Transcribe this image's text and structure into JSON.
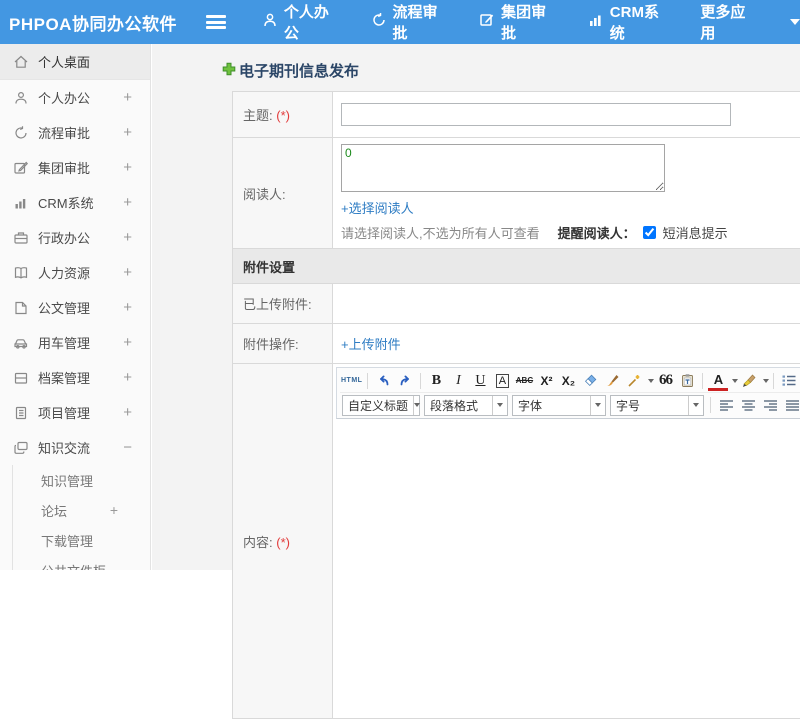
{
  "header": {
    "logo": "PHPOA协同办公软件",
    "nav": [
      {
        "label": "个人办公"
      },
      {
        "label": "流程审批"
      },
      {
        "label": "集团审批"
      },
      {
        "label": "CRM系统"
      },
      {
        "label": "更多应用"
      }
    ]
  },
  "sidebar": {
    "items": [
      {
        "label": "个人桌面",
        "toggle": ""
      },
      {
        "label": "个人办公",
        "toggle": "+"
      },
      {
        "label": "流程审批",
        "toggle": "+"
      },
      {
        "label": "集团审批",
        "toggle": "+"
      },
      {
        "label": "CRM系统",
        "toggle": "+"
      },
      {
        "label": "行政办公",
        "toggle": "+"
      },
      {
        "label": "人力资源",
        "toggle": "+"
      },
      {
        "label": "公文管理",
        "toggle": "+"
      },
      {
        "label": "用车管理",
        "toggle": "+"
      },
      {
        "label": "档案管理",
        "toggle": "+"
      },
      {
        "label": "项目管理",
        "toggle": "+"
      },
      {
        "label": "知识交流",
        "toggle": "−"
      }
    ],
    "subitems": [
      {
        "label": "知识管理",
        "toggle": ""
      },
      {
        "label": "论坛",
        "toggle": "+"
      },
      {
        "label": "下载管理",
        "toggle": ""
      },
      {
        "label": "公共文件柜",
        "toggle": ""
      }
    ]
  },
  "main": {
    "title": "电子期刊信息发布",
    "form": {
      "required": "(*)",
      "subject_label": "主题:",
      "subject_value": "",
      "readers_label": "阅读人:",
      "readers_value": "0",
      "choose_readers_link": "+选择阅读人",
      "readers_hint": "请选择阅读人,不选为所有人可查看",
      "remind_label": "提醒阅读人：",
      "sms_checkbox_label": "短消息提示",
      "sms_checked": true,
      "attachment_section": "附件设置",
      "uploaded_label": "已上传附件:",
      "attachment_op_label": "附件操作:",
      "upload_link": "+上传附件",
      "content_label": "内容:"
    }
  },
  "editor": {
    "toolbar": {
      "html": "HTML",
      "bold": "B",
      "italic": "I",
      "underline": "U",
      "fontbox": "A",
      "strike": "ABC",
      "sup": "X²",
      "sub": "X₂",
      "quote": "66",
      "font_color": "A"
    },
    "selects": [
      {
        "label": "自定义标题"
      },
      {
        "label": "段落格式"
      },
      {
        "label": "字体"
      },
      {
        "label": "字号"
      }
    ]
  },
  "colors": {
    "header_blue": "#4397e2",
    "link_blue": "#2e7cc3",
    "required_red": "#e23b3b",
    "plus_green": "#5cb531",
    "section_gray": "#e9e9e9"
  }
}
